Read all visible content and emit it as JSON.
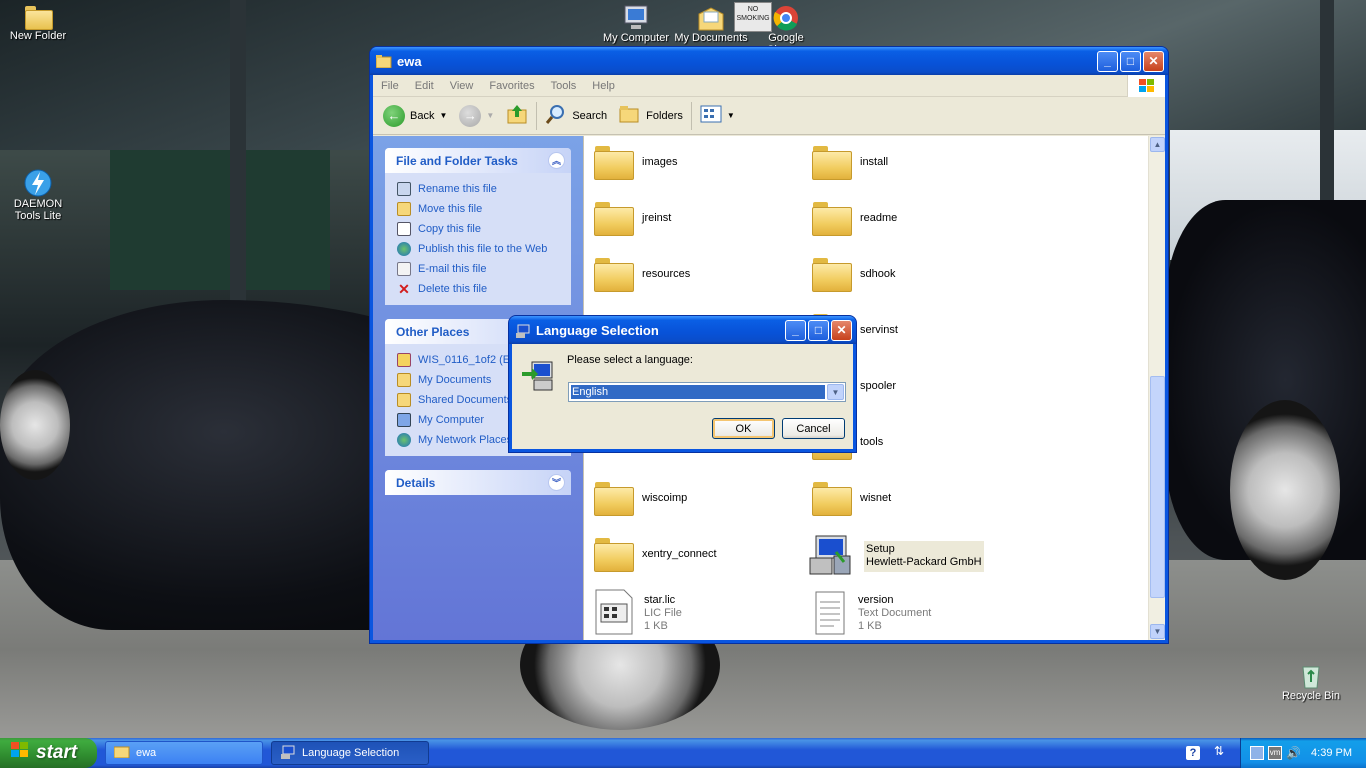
{
  "desktop": {
    "icons": {
      "new_folder": "New Folder",
      "my_computer": "My Computer",
      "my_documents": "My Documents",
      "google_chrome": "Google Chrome",
      "daemon_tools": "DAEMON Tools Lite",
      "recycle_bin": "Recycle Bin",
      "no_smoking_sign": "NO SMOKING"
    }
  },
  "explorer": {
    "title": "ewa",
    "menu": [
      "File",
      "Edit",
      "View",
      "Favorites",
      "Tools",
      "Help"
    ],
    "toolbar": {
      "back": "Back",
      "search": "Search",
      "folders": "Folders"
    },
    "tasks": {
      "header": "File and Folder Tasks",
      "items": [
        "Rename this file",
        "Move this file",
        "Copy this file",
        "Publish this file to the Web",
        "E-mail this file",
        "Delete this file"
      ]
    },
    "other_places": {
      "header": "Other Places",
      "items": [
        "WIS_0116_1of2 (E:)",
        "My Documents",
        "Shared Documents",
        "My Computer",
        "My Network Places"
      ]
    },
    "details": {
      "header": "Details"
    },
    "files": {
      "images": "images",
      "install": "install",
      "jreinst": "jreinst",
      "readme": "readme",
      "resources": "resources",
      "sdhook": "sdhook",
      "servinst": "servinst",
      "spooler": "spooler",
      "tools": "tools",
      "wiscoimp": "wiscoimp",
      "wisnet": "wisnet",
      "xentry_connect": "xentry_connect",
      "setup": {
        "name": "Setup",
        "company": "Hewlett-Packard GmbH"
      },
      "star_lic": {
        "name": "star.lic",
        "type": "LIC File",
        "size": "1 KB"
      },
      "version": {
        "name": "version",
        "type": "Text Document",
        "size": "1 KB"
      }
    }
  },
  "dialog": {
    "title": "Language Selection",
    "prompt": "Please select a language:",
    "selected_language": "English",
    "ok": "OK",
    "cancel": "Cancel"
  },
  "taskbar": {
    "start": "start",
    "tasks": [
      "ewa",
      "Language Selection"
    ],
    "clock": "4:39 PM"
  }
}
